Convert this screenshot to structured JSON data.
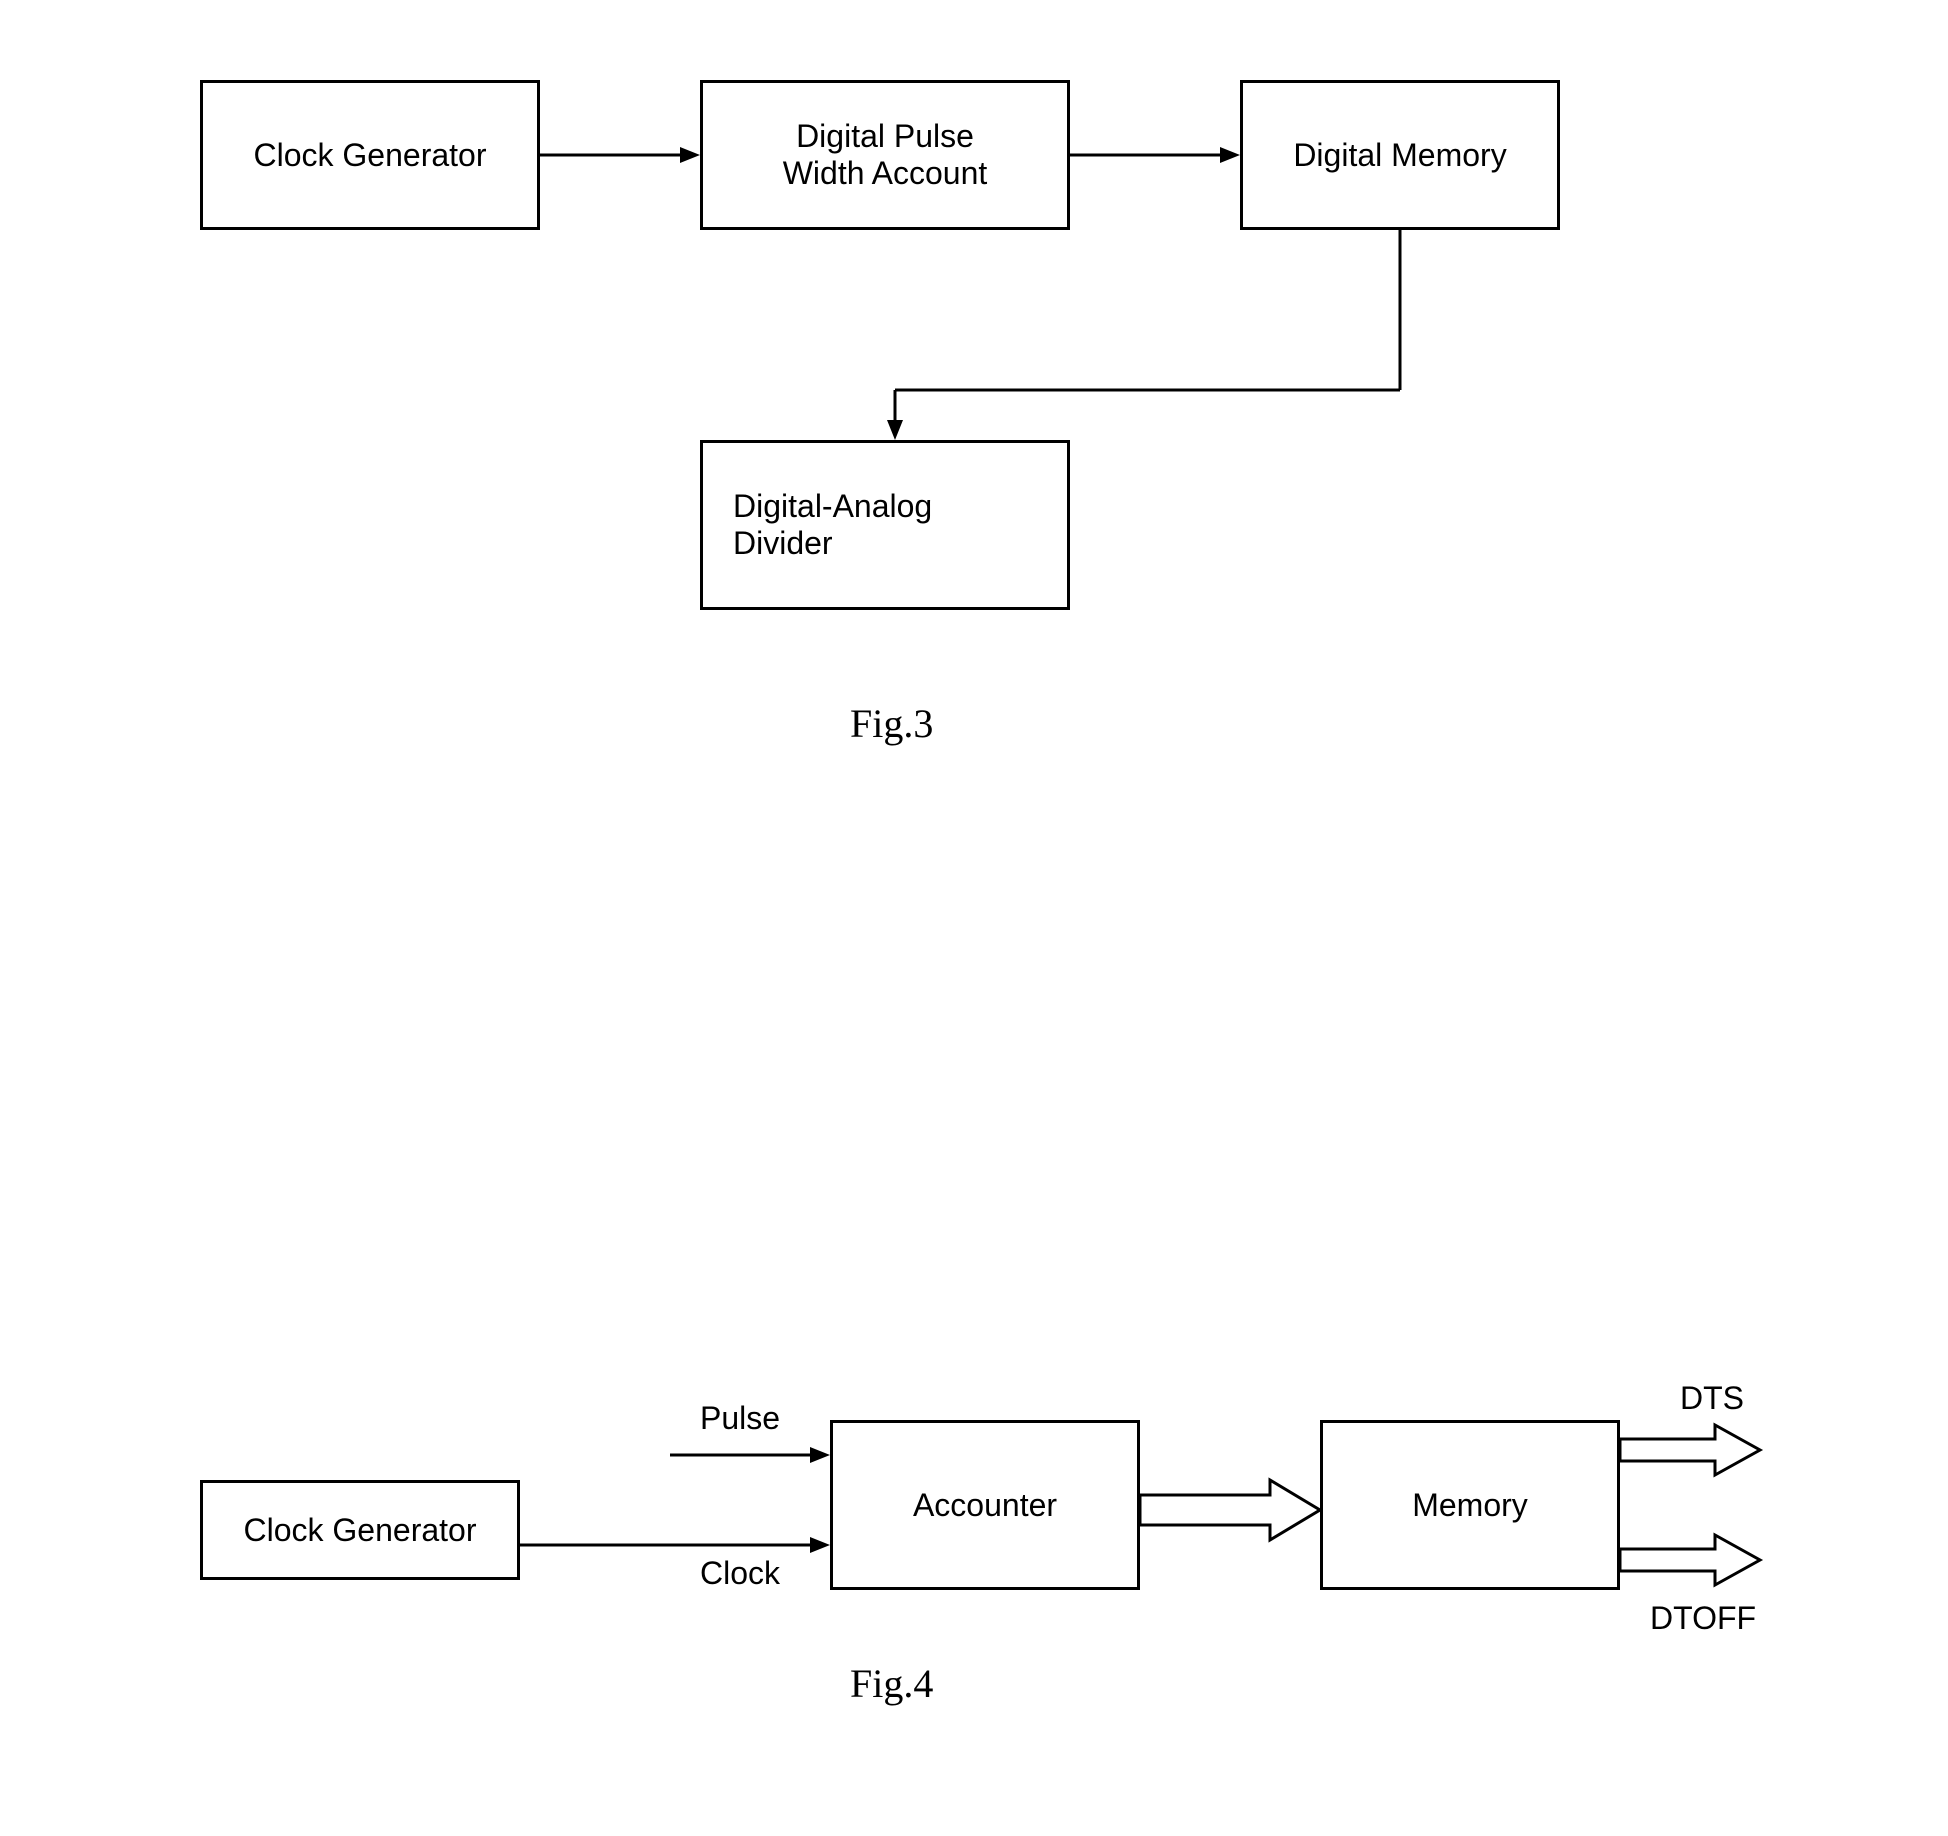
{
  "fig3": {
    "box1": "Clock Generator",
    "box2": "Digital Pulse\nWidth Account",
    "box3": "Digital Memory",
    "box4": "Digital-Analog\nDivider",
    "caption": "Fig.3"
  },
  "fig4": {
    "box1": "Clock Generator",
    "box2": "Accounter",
    "box3": "Memory",
    "input1": "Pulse",
    "input2": "Clock",
    "output1": "DTS",
    "output2": "DTOFF",
    "caption": "Fig.4"
  }
}
